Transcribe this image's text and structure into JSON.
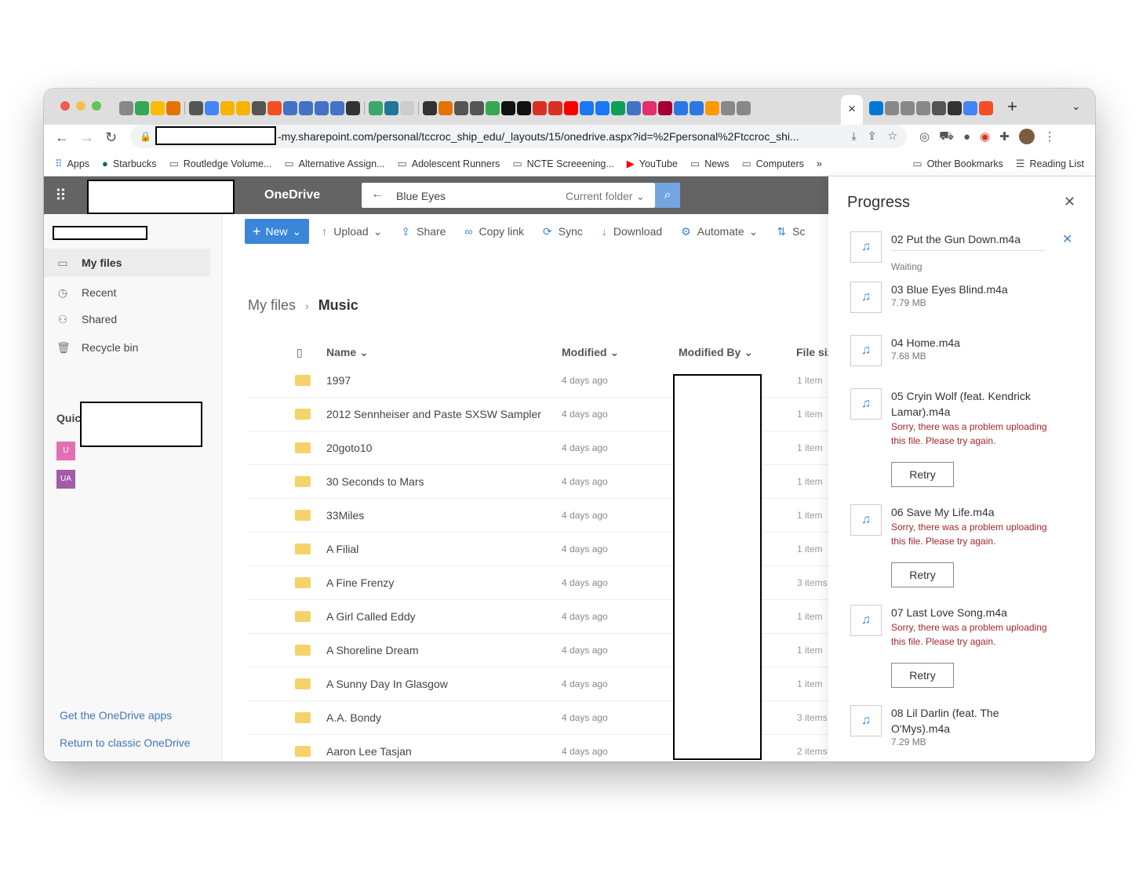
{
  "browser": {
    "url_suffix": "-my.sharepoint.com/personal/tccroc_ship_edu/_layouts/15/onedrive.aspx?id=%2Fpersonal%2Ftccroc_shi...",
    "active_tab_close": "×",
    "new_tab": "+",
    "bookmarks": [
      "Apps",
      "Starbucks",
      "Routledge Volume...",
      "Alternative Assign...",
      "Adolescent Runners",
      "NCTE Screeening...",
      "YouTube",
      "News",
      "Computers"
    ],
    "bookmarks_overflow": "»",
    "other_bookmarks": "Other Bookmarks",
    "reading_list": "Reading List"
  },
  "header": {
    "app_title": "OneDrive",
    "search_value": "Blue Eyes",
    "search_scope": "Current folder"
  },
  "sidebar": {
    "items": [
      "My files",
      "Recent",
      "Shared",
      "Recycle bin"
    ],
    "quick_access_label": "Quick access",
    "qa_avatars": [
      "U",
      "UA"
    ],
    "get_apps": "Get the OneDrive apps",
    "return_classic": "Return to classic OneDrive"
  },
  "commands": {
    "new": "New",
    "upload": "Upload",
    "share": "Share",
    "copy_link": "Copy link",
    "sync": "Sync",
    "download": "Download",
    "automate": "Automate",
    "sort": "Sc"
  },
  "breadcrumb": {
    "root": "My files",
    "current": "Music"
  },
  "table": {
    "headers": {
      "name": "Name",
      "modified": "Modified",
      "modified_by": "Modified By",
      "file_size": "File siz"
    },
    "rows": [
      {
        "name": "1997",
        "modified": "4 days ago",
        "size": "1 item"
      },
      {
        "name": "2012 Sennheiser and Paste SXSW Sampler",
        "modified": "4 days ago",
        "size": "1 item"
      },
      {
        "name": "20goto10",
        "modified": "4 days ago",
        "size": "1 item"
      },
      {
        "name": "30 Seconds to Mars",
        "modified": "4 days ago",
        "size": "1 item"
      },
      {
        "name": "33Miles",
        "modified": "4 days ago",
        "size": "1 item"
      },
      {
        "name": "A Filial",
        "modified": "4 days ago",
        "size": "1 item"
      },
      {
        "name": "A Fine Frenzy",
        "modified": "4 days ago",
        "size": "3 items"
      },
      {
        "name": "A Girl Called Eddy",
        "modified": "4 days ago",
        "size": "1 item"
      },
      {
        "name": "A Shoreline Dream",
        "modified": "4 days ago",
        "size": "1 item"
      },
      {
        "name": "A Sunny Day In Glasgow",
        "modified": "4 days ago",
        "size": "1 item"
      },
      {
        "name": "A.A. Bondy",
        "modified": "4 days ago",
        "size": "3 items"
      },
      {
        "name": "Aaron Lee Tasjan",
        "modified": "4 days ago",
        "size": "2 items"
      }
    ]
  },
  "progress": {
    "title": "Progress",
    "items": [
      {
        "name": "02 Put the Gun Down.m4a",
        "meta": "Waiting"
      },
      {
        "name": "03 Blue Eyes Blind.m4a",
        "meta": "7.79 MB"
      },
      {
        "name": "04 Home.m4a",
        "meta": "7.68 MB"
      },
      {
        "name": "05 Cryin Wolf (feat. Kendrick Lamar).m4a",
        "error": "Sorry, there was a problem uploading this file. Please try again.",
        "retry": "Retry"
      },
      {
        "name": "06 Save My Life.m4a",
        "error": "Sorry, there was a problem uploading this file. Please try again.",
        "retry": "Retry"
      },
      {
        "name": "07 Last Love Song.m4a",
        "error": "Sorry, there was a problem uploading this file. Please try again.",
        "retry": "Retry"
      },
      {
        "name": "08 Lil Darlin (feat. The O'Mys).m4a",
        "meta": "7.29 MB"
      }
    ]
  },
  "colors": {
    "accent": "#3b86d8",
    "header_bg": "#646464",
    "error": "#a4262c",
    "folder": "#f5d36b"
  }
}
